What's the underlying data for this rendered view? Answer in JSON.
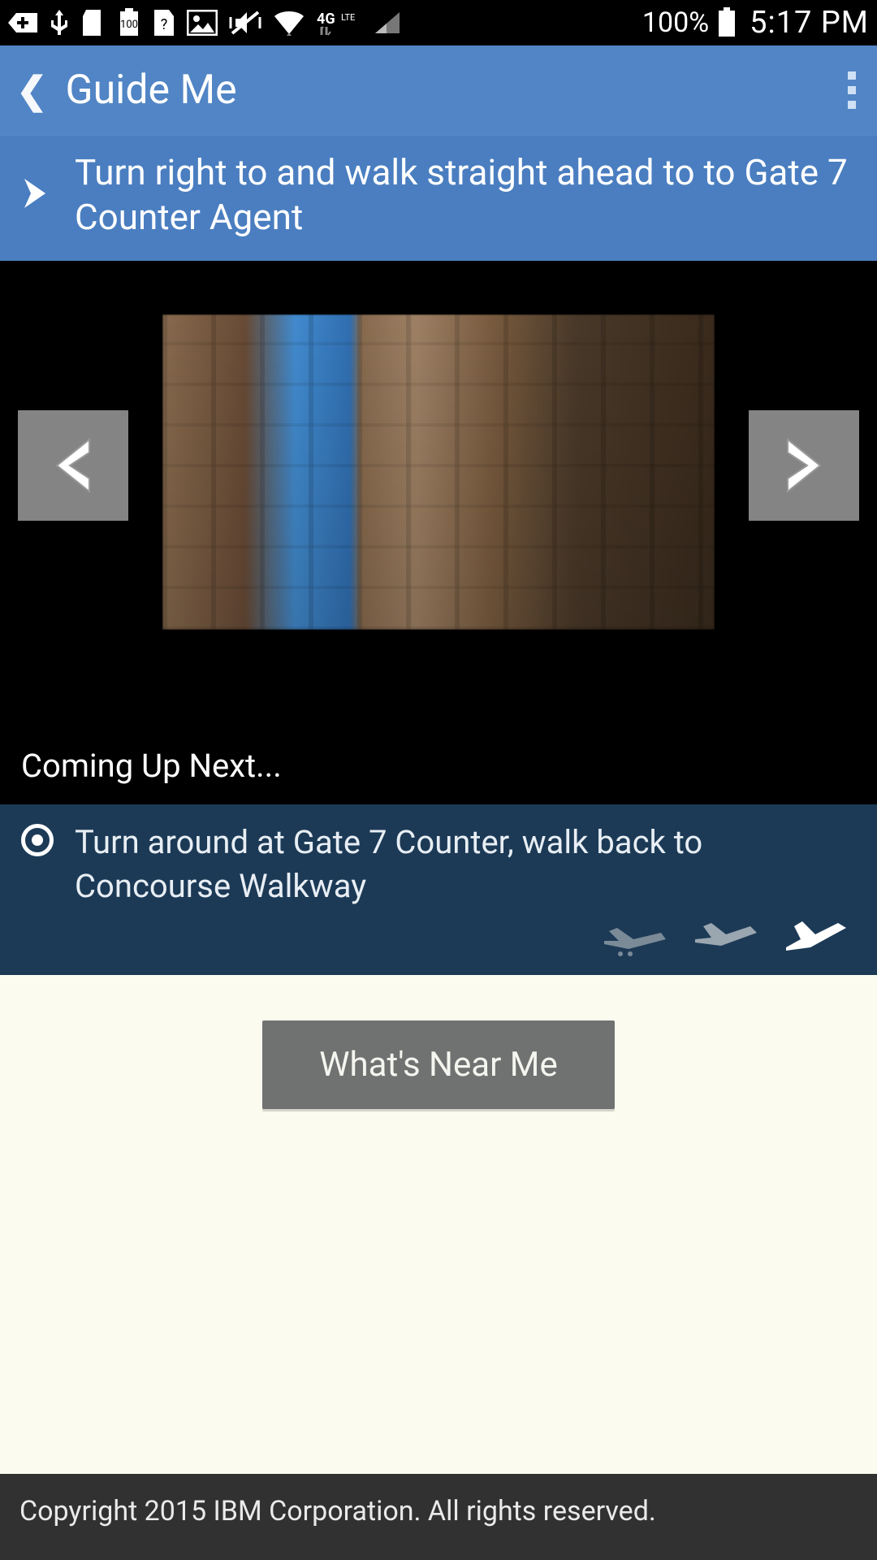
{
  "status": {
    "battery_text": "100%",
    "clock": "5:17 PM",
    "network_label": "4G LTE"
  },
  "app_bar": {
    "title": "Guide Me"
  },
  "instruction": {
    "text": "Turn right to and walk straight ahead to to Gate 7 Counter Agent"
  },
  "coming_up": {
    "heading": "Coming Up Next...",
    "next_step": "Turn around at Gate 7 Counter, walk back to Concourse Walkway"
  },
  "buttons": {
    "near_me": "What's Near Me"
  },
  "footer": {
    "copyright": "Copyright 2015 IBM Corporation. All rights reserved."
  }
}
